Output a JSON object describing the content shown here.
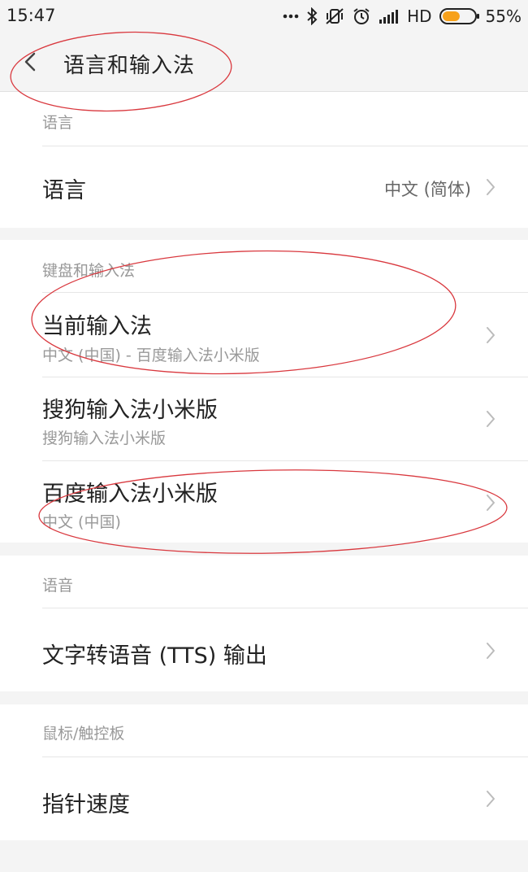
{
  "status_bar": {
    "time": "15:47",
    "network": "HD",
    "battery_percent": "55%",
    "battery_level": 0.55,
    "accent_color": "#f7a11a",
    "icons": [
      "more-dots-icon",
      "bluetooth-icon",
      "vibrate-off-icon",
      "alarm-icon",
      "signal-icon"
    ]
  },
  "header": {
    "back_icon": "chevron-left-icon",
    "title": "语言和输入法"
  },
  "sections": {
    "language": {
      "header": "语言",
      "rows": [
        {
          "title": "语言",
          "value": "中文 (简体)"
        }
      ]
    },
    "keyboard": {
      "header": "键盘和输入法",
      "rows": [
        {
          "title": "当前输入法",
          "subtitle": "中文 (中国) - 百度输入法小米版"
        },
        {
          "title": "搜狗输入法小米版",
          "subtitle": "搜狗输入法小米版"
        },
        {
          "title": "百度输入法小米版",
          "subtitle": "中文 (中国)"
        }
      ]
    },
    "speech": {
      "header": "语音",
      "rows": [
        {
          "title": "文字转语音 (TTS) 输出"
        }
      ]
    },
    "mouse": {
      "header": "鼠标/触控板",
      "rows": [
        {
          "title": "指针速度"
        }
      ]
    }
  },
  "annotation_color": "#d9383e"
}
